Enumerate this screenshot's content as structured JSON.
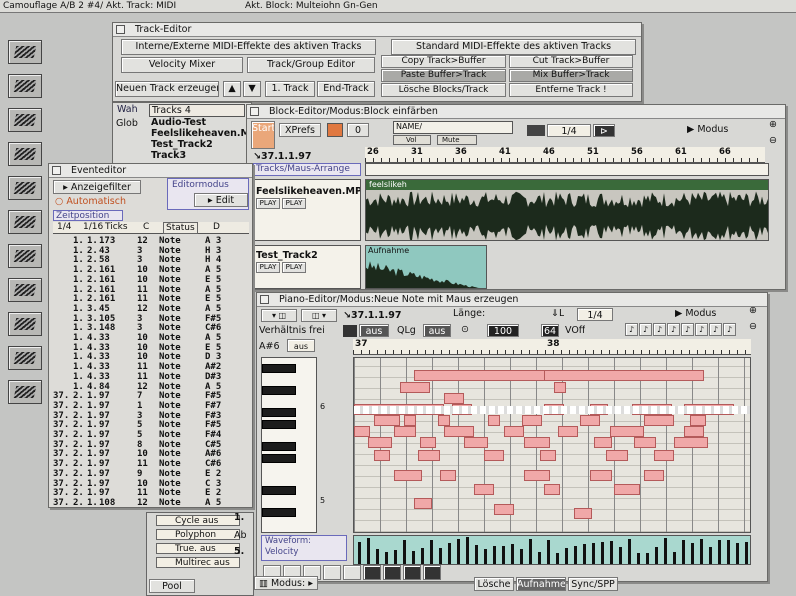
{
  "topbar": {
    "app_text": "Camouflage A/B 2 #4/ Akt. Track: MIDI",
    "block_text": "Akt. Block: Multeiohn Gn-Gen"
  },
  "sidebar": {
    "count": 11
  },
  "track_editor": {
    "title": "Track-Editor",
    "heading_left": "Interne/Externe MIDI-Effekte des aktiven Tracks",
    "heading_right": "Standard MIDI-Effekte des aktiven Tracks",
    "velocity_mixer": "Velocity Mixer",
    "track_group_editor": "Track/Group Editor",
    "copy_track_buffer": "Copy Track>Buffer",
    "cut_track_buffer": "Cut Track>Buffer",
    "paste_buffer_track": "Paste Buffer>Track",
    "mix_buffer_track": "Mix Buffer>Track",
    "loesche_blocks_track": "Lösche Blocks/Track",
    "entferne_track": "Entferne Track !",
    "neuen_track": "Neuen Track erzeugen",
    "first_track": "1. Track",
    "end_track": "End-Track",
    "list_head_left": "Wah",
    "list_head_right": "Tracks 4",
    "list_col": "Glob",
    "tracks": [
      "Audio-Test",
      "Feelslikeheaven.MPE",
      "Test_Track2",
      "Track3"
    ]
  },
  "block_editor": {
    "title": "Block-Editor/Modus:Block einfärben",
    "start": "Start",
    "xprefs": "XPrefs",
    "zero": "0",
    "name_label": "NAME/",
    "vol_label": "Vol",
    "mute_label": "Mute",
    "ratio": "1/4",
    "modus": "Modus",
    "position": "37.1.1.97",
    "tracks_label": "Tracks/Maus-Arrange",
    "track1_name": "Feelslikeheaven.MPEG",
    "track1_audio": "feelslikeh",
    "track2_name": "Test_Track2",
    "track2_block": "Aufnahme",
    "play": "PLAY",
    "rec": "PLAY",
    "ruler_marks": [
      "26",
      "31",
      "36",
      "41",
      "46",
      "51",
      "56",
      "61",
      "66"
    ]
  },
  "event_editor": {
    "title": "Eventeditor",
    "anzeigefilter": "Anzeigefilter",
    "automatisch": "Automatisch",
    "editor_modus": "Editormodus",
    "edit_btn": "Edit",
    "zeitposition": "Zeitposition",
    "col_left": "1/4",
    "col_mid": "1/16",
    "col_ticks": "Ticks",
    "col_c": "C",
    "col_status": "Status",
    "col_d": "D",
    "rows": [
      [
        "",
        "1.",
        "1.",
        "173",
        "12",
        "Note",
        "A 3"
      ],
      [
        "",
        "1.",
        "2.",
        "43",
        "3",
        "Note",
        "H 3"
      ],
      [
        "",
        "1.",
        "2.",
        "58",
        "3",
        "Note",
        "H 4"
      ],
      [
        "",
        "1.",
        "2.",
        "161",
        "10",
        "Note",
        "A 5"
      ],
      [
        "",
        "1.",
        "2.",
        "161",
        "10",
        "Note",
        "E 5"
      ],
      [
        "",
        "1.",
        "2.",
        "161",
        "11",
        "Note",
        "A 5"
      ],
      [
        "",
        "1.",
        "2.",
        "161",
        "11",
        "Note",
        "E 5"
      ],
      [
        "",
        "1.",
        "3.",
        "45",
        "12",
        "Note",
        "A 5"
      ],
      [
        "",
        "1.",
        "3.",
        "105",
        "3",
        "Note",
        "F#5"
      ],
      [
        "",
        "1.",
        "3.",
        "148",
        "3",
        "Note",
        "C#6"
      ],
      [
        "",
        "1.",
        "4.",
        "33",
        "10",
        "Note",
        "A 5"
      ],
      [
        "",
        "1.",
        "4.",
        "33",
        "10",
        "Note",
        "E 5"
      ],
      [
        "",
        "1.",
        "4.",
        "33",
        "10",
        "Note",
        "D 3"
      ],
      [
        "",
        "1.",
        "4.",
        "33",
        "11",
        "Note",
        "A#2"
      ],
      [
        "",
        "1.",
        "4.",
        "33",
        "11",
        "Note",
        "D#3"
      ],
      [
        "",
        "1.",
        "4.",
        "84",
        "12",
        "Note",
        "A 5"
      ],
      [
        "37.",
        "2.",
        "1.",
        "97",
        "7",
        "Note",
        "F#5"
      ],
      [
        "37.",
        "2.",
        "1.",
        "97",
        "1",
        "Note",
        "F#7"
      ],
      [
        "37.",
        "2.",
        "1.",
        "97",
        "3",
        "Note",
        "F#3"
      ],
      [
        "37.",
        "2.",
        "1.",
        "97",
        "5",
        "Note",
        "F#5"
      ],
      [
        "37.",
        "2.",
        "1.",
        "97",
        "5",
        "Note",
        "F#4"
      ],
      [
        "37.",
        "2.",
        "1.",
        "97",
        "8",
        "Note",
        "C#5"
      ],
      [
        "37.",
        "2.",
        "1.",
        "97",
        "10",
        "Note",
        "A#6"
      ],
      [
        "37.",
        "2.",
        "1.",
        "97",
        "11",
        "Note",
        "C#6"
      ],
      [
        "37.",
        "2.",
        "1.",
        "97",
        "9",
        "Note",
        "E 2"
      ],
      [
        "37.",
        "2.",
        "1.",
        "97",
        "10",
        "Note",
        "C 3"
      ],
      [
        "37.",
        "2.",
        "1.",
        "97",
        "11",
        "Note",
        "E 2"
      ],
      [
        "37.",
        "2.",
        "1.",
        "108",
        "12",
        "Note",
        "A 5"
      ]
    ]
  },
  "piano_editor": {
    "title": "Piano-Editor/Modus:Neue Note mit Maus erzeugen",
    "position": "37.1.1.97",
    "ratio": "1/4",
    "modus": "Modus",
    "laenge": "Länge:",
    "verhaeltnis": "Verhältnis frei",
    "aus1": "aus",
    "qlg": "QLg",
    "aus2": "aus",
    "aus3": "aus",
    "note_label": "A#6",
    "vel_value": "100",
    "sixtyfour": "64",
    "voff": "VOff",
    "ruler_left": "37",
    "ruler_right": "38",
    "octave_top": "6",
    "octave_bottom": "5",
    "waveform": "Waveform:",
    "velocity": "Velocity"
  },
  "bottom_panel": {
    "cycle": "Cycle aus",
    "polyphon": "Polyphon",
    "true": "True. aus",
    "multirec": "Multirec aus",
    "pool": "Pool",
    "modus": "Modus:",
    "num1": "1.",
    "ab": "Ab",
    "num5": "5."
  },
  "transport": {
    "loesche": "Lösche",
    "aufnahme": "Aufnahme",
    "sync": "Sync/SPP"
  }
}
